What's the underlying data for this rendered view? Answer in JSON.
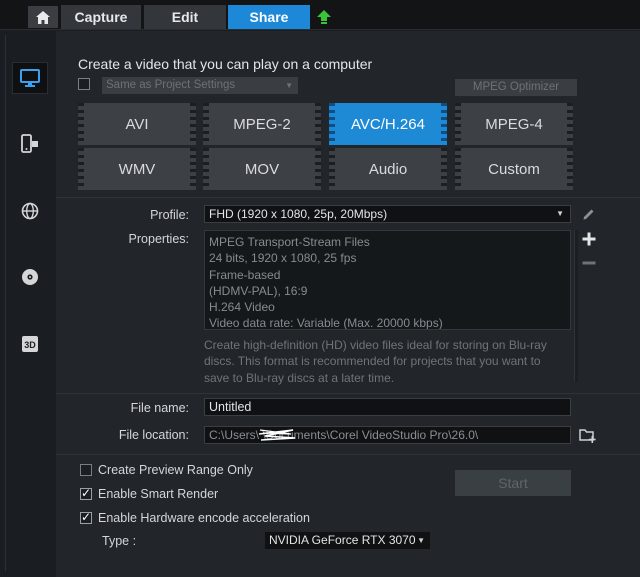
{
  "topbar": {
    "tabs": [
      {
        "label": "Capture"
      },
      {
        "label": "Edit"
      },
      {
        "label": "Share"
      }
    ],
    "active_tab": "Share",
    "accent_color": "#1e88d8"
  },
  "sidebar": {
    "items": [
      {
        "icon": "monitor-icon",
        "active": true
      },
      {
        "icon": "mobile-device-icon",
        "active": false
      },
      {
        "icon": "globe-icon",
        "active": false
      },
      {
        "icon": "disc-icon",
        "active": false
      },
      {
        "icon": "3d-icon",
        "label": "3D",
        "active": false
      }
    ]
  },
  "main": {
    "heading": "Create a video that you can play on a computer",
    "same_as_project": {
      "label": "Same as Project Settings",
      "checked": false,
      "enabled": false
    },
    "mpeg_optimizer_label": "MPEG Optimizer",
    "formats": [
      {
        "label": "AVI"
      },
      {
        "label": "MPEG-2"
      },
      {
        "label": "AVC/H.264"
      },
      {
        "label": "MPEG-4"
      },
      {
        "label": "WMV"
      },
      {
        "label": "MOV"
      },
      {
        "label": "Audio"
      },
      {
        "label": "Custom"
      }
    ],
    "selected_format": "AVC/H.264",
    "profile": {
      "label": "Profile:",
      "value": "FHD (1920 x 1080, 25p, 20Mbps)"
    },
    "properties": {
      "label": "Properties:",
      "lines": [
        "MPEG Transport-Stream Files",
        "24 bits, 1920 x 1080, 25 fps",
        "Frame-based",
        "(HDMV-PAL),  16:9",
        "H.264 Video",
        "Video data rate: Variable (Max. 20000 kbps)"
      ]
    },
    "description": "Create high-definition (HD) video files ideal for storing on Blu-ray discs. This format is recommended for projects that you want to save to Blu-ray discs at a later time.",
    "file_name": {
      "label": "File name:",
      "value": "Untitled"
    },
    "file_location": {
      "label": "File location:",
      "value": "C:\\Users\\        \\Documents\\Corel VideoStudio Pro\\26.0\\"
    },
    "options": [
      {
        "label": "Create Preview Range Only",
        "checked": false
      },
      {
        "label": "Enable Smart Render",
        "checked": true
      },
      {
        "label": "Enable Hardware encode acceleration",
        "checked": true
      }
    ],
    "start_label": "Start",
    "type": {
      "label": "Type :",
      "value": "NVIDIA GeForce RTX 3070"
    }
  }
}
